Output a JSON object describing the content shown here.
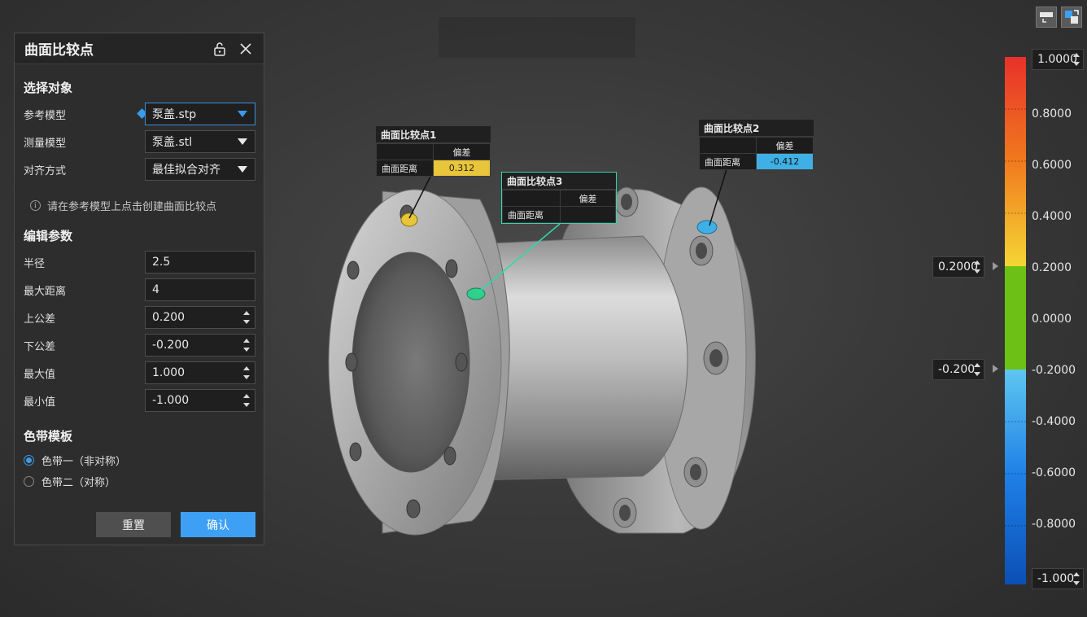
{
  "panel": {
    "title": "曲面比较点",
    "section_select": "选择对象",
    "ref_model_label": "参考模型",
    "ref_model_value": "泵盖.stp",
    "meas_model_label": "测量模型",
    "meas_model_value": "泵盖.stl",
    "align_label": "对齐方式",
    "align_value": "最佳拟合对齐",
    "hint": "请在参考模型上点击创建曲面比较点",
    "section_params": "编辑参数",
    "radius_label": "半径",
    "radius_value": "2.5",
    "maxdist_label": "最大距离",
    "maxdist_value": "4",
    "upper_tol_label": "上公差",
    "upper_tol_value": "0.200",
    "lower_tol_label": "下公差",
    "lower_tol_value": "-0.200",
    "max_label": "最大值",
    "max_value": "1.000",
    "min_label": "最小值",
    "min_value": "-1.000",
    "section_template": "色带模板",
    "template_1": "色带一（非对称）",
    "template_2": "色带二（对称）",
    "reset_label": "重置",
    "confirm_label": "确认"
  },
  "callouts": [
    {
      "title": "曲面比较点1",
      "header": "偏差",
      "row_label": "曲面距离",
      "value": "0.312",
      "color": "#e8c53a"
    },
    {
      "title": "曲面比较点2",
      "header": "偏差",
      "row_label": "曲面距离",
      "value": "-0.412",
      "color": "#3fb0e6"
    },
    {
      "title": "曲面比较点3",
      "header": "偏差",
      "row_label": "曲面距离",
      "value": "",
      "color": "#2fd8a8"
    }
  ],
  "colorbar": {
    "max_box": "1.0000",
    "min_box": "-1.000",
    "upper_box": "0.2000",
    "lower_box": "-0.200",
    "ticks": [
      "0.8000",
      "0.6000",
      "0.4000",
      "0.2000",
      "0.0000",
      "-0.2000",
      "-0.4000",
      "-0.6000",
      "-0.8000"
    ],
    "colors": {
      "red": "#e8312a",
      "orange": "#f07a1e",
      "yellow": "#f5d634",
      "green": "#6dc015",
      "light_blue": "#5ec6f0",
      "blue": "#1e7fe6",
      "dark_blue": "#0b4fb5"
    }
  }
}
